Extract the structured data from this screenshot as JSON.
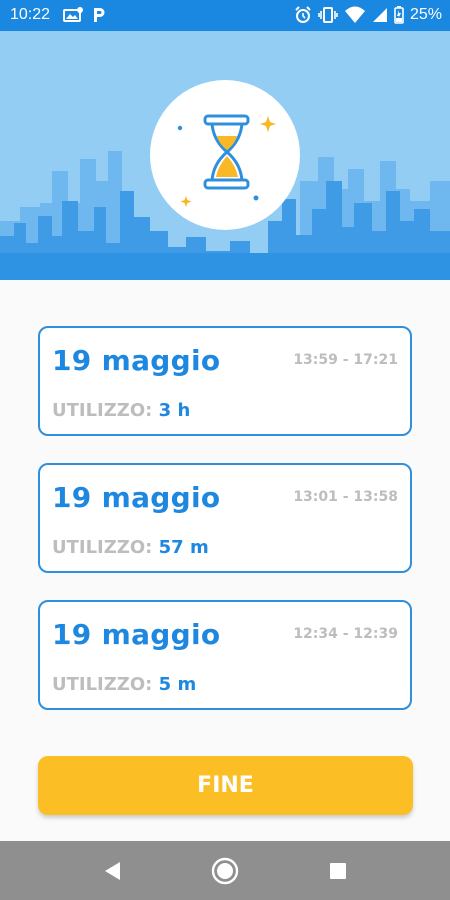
{
  "status_bar": {
    "time": "10:22",
    "battery": "25%",
    "icons": [
      "gallery-icon",
      "parking-icon",
      "alarm-icon",
      "vibrate-icon",
      "wifi-icon",
      "signal-icon",
      "battery-icon"
    ]
  },
  "colors": {
    "status_bar": "#1a88e0",
    "header_bg": "#93cdf4",
    "accent_blue": "#1e88e0",
    "label_gray": "#bdbdbd",
    "button_yellow": "#fbbf25",
    "nav_bar": "#8f8f8f"
  },
  "header": {
    "logo_icon": "hourglass-icon"
  },
  "sessions": [
    {
      "date": "19 maggio",
      "time_range": "13:59 - 17:21",
      "usage_label": "UTILIZZO:",
      "usage_value": "3 h"
    },
    {
      "date": "19 maggio",
      "time_range": "13:01 - 13:58",
      "usage_label": "UTILIZZO:",
      "usage_value": "57 m"
    },
    {
      "date": "19 maggio",
      "time_range": "12:34 - 12:39",
      "usage_label": "UTILIZZO:",
      "usage_value": "5 m"
    }
  ],
  "done_button": {
    "label": "FINE"
  },
  "nav": {
    "back": "back-icon",
    "home": "home-icon",
    "recents": "recents-icon"
  }
}
